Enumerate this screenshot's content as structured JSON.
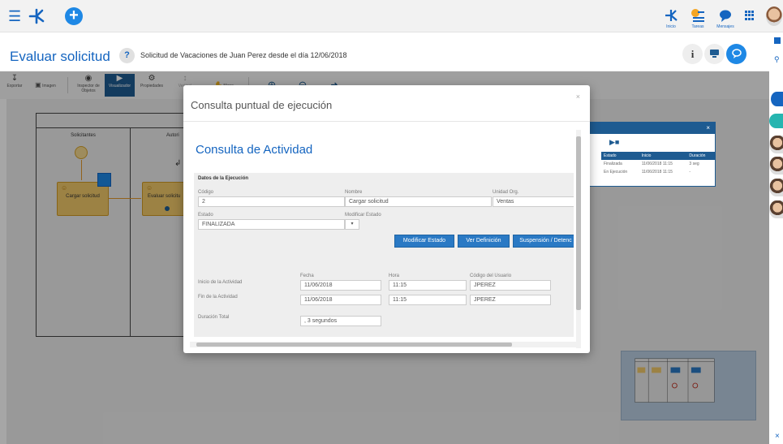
{
  "topbar": {
    "nav": [
      {
        "label": "Inicio"
      },
      {
        "label": "Tareas"
      },
      {
        "label": "Mensajes"
      }
    ]
  },
  "header": {
    "title": "Evaluar solicitud",
    "help": "?",
    "subtitle": "Solicitud de Vacaciones de Juan  Perez desde el día 12/06/2018",
    "info_icon": "i"
  },
  "toolbar": {
    "items": [
      {
        "label": "Exportar",
        "icon": "download-icon"
      },
      {
        "label": "Imagen",
        "icon": "image-icon"
      },
      {
        "label": "Inspector de Objetos",
        "icon": "inspector-icon"
      },
      {
        "label": "Visualizador",
        "icon": "viewer-icon"
      },
      {
        "label": "Propiedades",
        "icon": "gear-icon"
      },
      {
        "label": "Vertical",
        "icon": "vertical-icon"
      },
      {
        "label": "Mano",
        "icon": "hand-icon"
      }
    ]
  },
  "diagram": {
    "lanes": [
      "Solicitantes",
      "Autori"
    ],
    "tasks": [
      "Cargar solicitud",
      "Evaluar solicitu"
    ]
  },
  "exec_panel": {
    "close": "×",
    "headers": [
      "Estado",
      "Inicio",
      "Duración"
    ],
    "rows": [
      [
        "Finalizada",
        "11/06/2018 11:15",
        "3 seg"
      ],
      [
        "En Ejecución",
        "11/06/2018 11:15",
        "-"
      ]
    ]
  },
  "modal": {
    "title": "Consulta puntual de ejecución",
    "close": "×",
    "heading": "Consulta de Actividad",
    "section_title": "Datos de la Ejecución",
    "fields": {
      "codigo_label": "Código",
      "codigo": "2",
      "nombre_label": "Nombre",
      "nombre": "Cargar solicitud",
      "unidad_label": "Unidad Org.",
      "unidad": "Ventas",
      "estado_label": "Estado",
      "estado": "FINALIZADA",
      "modificar_label": "Modificar Estado",
      "modificar_value": ""
    },
    "buttons": {
      "modificar": "Modificar Estado",
      "ver": "Ver Definición",
      "suspension": "Suspensión / Detenc"
    },
    "timing": {
      "fecha_label": "Fecha",
      "hora_label": "Hora",
      "usuario_label": "Código del Usuario",
      "inicio_label": "Inicio de la Actividad",
      "inicio_fecha": "11/06/2018",
      "inicio_hora": "11:15",
      "inicio_usuario": "JPEREZ",
      "fin_label": "Fin de la Actividad",
      "fin_fecha": "11/06/2018",
      "fin_hora": "11:15",
      "fin_usuario": "JPEREZ",
      "duracion_label": "Duración Total",
      "duracion": ", 3 segundos"
    }
  },
  "colors": {
    "primary": "#1565c0",
    "toolbar_active": "#1e5b91",
    "button": "#2a79c4",
    "task_fill": "#f0c869",
    "accent_orange": "#f5a623"
  }
}
